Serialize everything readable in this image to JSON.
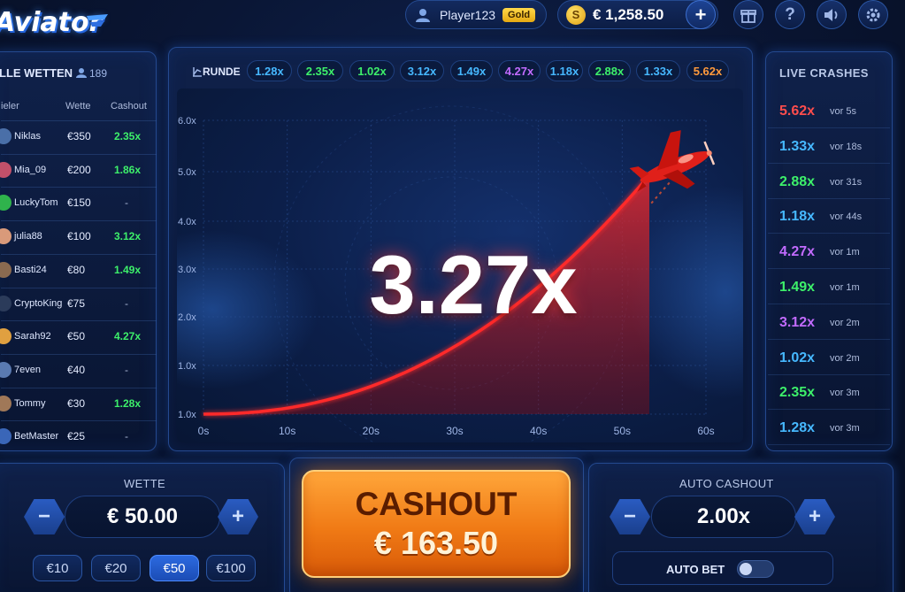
{
  "header": {
    "logo": "Aviator",
    "username": "Player123",
    "rank_badge": "Gold",
    "balance": "€ 1,258.50",
    "coin_symbol": "S",
    "add_label": "+"
  },
  "bets_panel": {
    "title": "LLE WETTEN",
    "player_count": "189",
    "col_player": "ieler",
    "col_bet": "Wette",
    "col_cashout": "Cashout",
    "rows": [
      {
        "name": "Niklas",
        "bet": "€350",
        "cashout": "2.35x",
        "avatar_color": "#4a6fa8"
      },
      {
        "name": "Mia_09",
        "bet": "€200",
        "cashout": "1.86x",
        "avatar_color": "#c2506a"
      },
      {
        "name": "LuckyTom",
        "bet": "€150",
        "cashout": "-",
        "avatar_color": "#2fb34c"
      },
      {
        "name": "julia88",
        "bet": "€100",
        "cashout": "3.12x",
        "avatar_color": "#d99a7a"
      },
      {
        "name": "Basti24",
        "bet": "€80",
        "cashout": "1.49x",
        "avatar_color": "#8a6a50"
      },
      {
        "name": "CryptoKing",
        "bet": "€75",
        "cashout": "-",
        "avatar_color": "#2b3b5a"
      },
      {
        "name": "Sarah92",
        "bet": "€50",
        "cashout": "4.27x",
        "avatar_color": "#e0a040"
      },
      {
        "name": "7even",
        "bet": "€40",
        "cashout": "-",
        "avatar_color": "#5a7ab0"
      },
      {
        "name": "Tommy",
        "bet": "€30",
        "cashout": "1.28x",
        "avatar_color": "#a07858"
      },
      {
        "name": "BetMaster",
        "bet": "€25",
        "cashout": "-",
        "avatar_color": "#3a66b8"
      }
    ]
  },
  "rounds_bar": {
    "label": "RUNDE",
    "chips": [
      {
        "value": "1.28x",
        "color": "#46b8ff"
      },
      {
        "value": "2.35x",
        "color": "#3df06a"
      },
      {
        "value": "1.02x",
        "color": "#3df06a"
      },
      {
        "value": "3.12x",
        "color": "#46b8ff"
      },
      {
        "value": "1.49x",
        "color": "#46b8ff"
      },
      {
        "value": "4.27x",
        "color": "#c26bff"
      },
      {
        "value": "1.18x",
        "color": "#46b8ff"
      },
      {
        "value": "2.88x",
        "color": "#3df06a"
      },
      {
        "value": "1.33x",
        "color": "#46b8ff"
      },
      {
        "value": "5.62x",
        "color": "#ff9a3c"
      }
    ]
  },
  "game": {
    "multiplier": "3.27x",
    "y_ticks": [
      "1.0x",
      "1.0x",
      "2.0x",
      "3.0x",
      "4.0x",
      "5.0x",
      "6.0x"
    ],
    "x_ticks": [
      "0s",
      "10s",
      "20s",
      "30s",
      "40s",
      "50s",
      "60s"
    ],
    "curve_color": "#ff2a2a"
  },
  "live_crashes": {
    "title": "LIVE CRASHES",
    "items": [
      {
        "value": "5.62x",
        "time": "vor 5s",
        "color": "#ff4d4d"
      },
      {
        "value": "1.33x",
        "time": "vor 18s",
        "color": "#46b8ff"
      },
      {
        "value": "2.88x",
        "time": "vor 31s",
        "color": "#3df06a"
      },
      {
        "value": "1.18x",
        "time": "vor 44s",
        "color": "#46b8ff"
      },
      {
        "value": "4.27x",
        "time": "vor 1m",
        "color": "#c26bff"
      },
      {
        "value": "1.49x",
        "time": "vor 1m",
        "color": "#3df06a"
      },
      {
        "value": "3.12x",
        "time": "vor 2m",
        "color": "#c26bff"
      },
      {
        "value": "1.02x",
        "time": "vor 2m",
        "color": "#46b8ff"
      },
      {
        "value": "2.35x",
        "time": "vor 3m",
        "color": "#3df06a"
      },
      {
        "value": "1.28x",
        "time": "vor 3m",
        "color": "#46b8ff"
      }
    ]
  },
  "bet_control": {
    "title": "WETTE",
    "value": "€ 50.00",
    "minus": "−",
    "plus": "+",
    "quick_amounts": [
      "€10",
      "€20",
      "€50",
      "€100"
    ],
    "active_amount": "€50"
  },
  "cashout_button": {
    "label": "CASHOUT",
    "amount": "€ 163.50"
  },
  "auto_cashout": {
    "title": "AUTO CASHOUT",
    "value": "2.00x",
    "minus": "−",
    "plus": "+",
    "auto_bet_label": "AUTO BET",
    "auto_bet_on": false
  },
  "icons": [
    "user-icon",
    "coin-icon",
    "gift-icon",
    "help-icon",
    "sound-icon",
    "settings-icon",
    "users-icon",
    "round-history-icon",
    "plane-icon"
  ]
}
